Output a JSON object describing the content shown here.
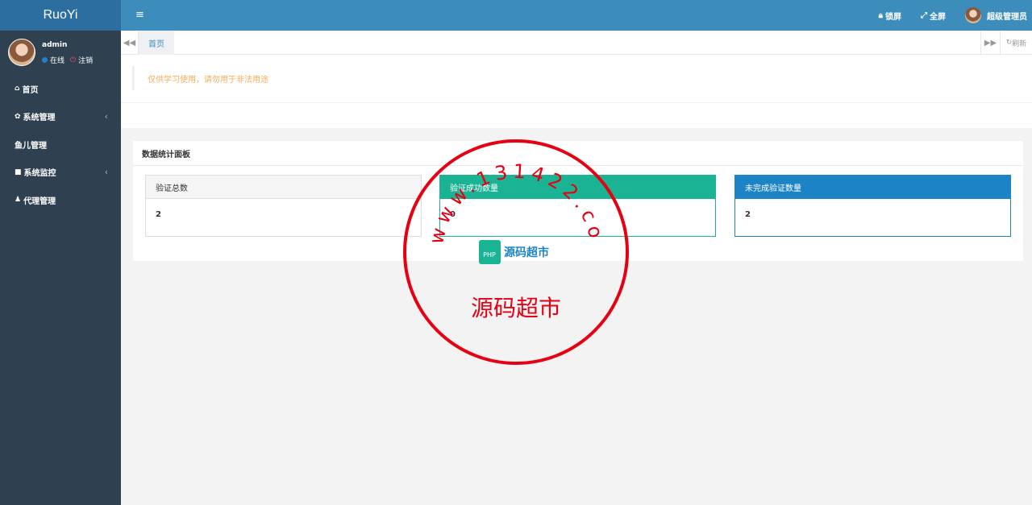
{
  "sidebar": {
    "logo": "RuoYi",
    "user": {
      "name": "admin",
      "status": "在线",
      "logout": "注销"
    },
    "items": [
      {
        "label": "首页",
        "icon": "home-icon",
        "glyph": "⌂"
      },
      {
        "label": "系统管理",
        "icon": "gear-icon",
        "glyph": "✿",
        "arrow": "‹"
      },
      {
        "label": "鱼儿管理",
        "icon": "",
        "glyph": ""
      },
      {
        "label": "系统监控",
        "icon": "video-icon",
        "glyph": "■",
        "arrow": "‹"
      },
      {
        "label": "代理管理",
        "icon": "user-icon",
        "glyph": "♟"
      }
    ]
  },
  "header": {
    "menu_glyph": "≡",
    "lock_label": "锁屏",
    "fullscreen_label": "全屏",
    "user_label": "超级管理员"
  },
  "tabs": {
    "home": "首页",
    "refresh": "刷新"
  },
  "notice": "仅供学习使用，请勿用于非法用途",
  "stats": {
    "title": "数据统计面板",
    "cards": [
      {
        "label": "验证总数",
        "value": "2"
      },
      {
        "label": "验证成功数量",
        "value": "0"
      },
      {
        "label": "未完成验证数量",
        "value": "2"
      }
    ]
  },
  "watermark": {
    "url": "www.131422.com",
    "name": "源码超市",
    "logo_badge": "PHP",
    "logo_text": "源码超市",
    "color": "#e60012"
  },
  "colors": {
    "sidebar_bg": "#2f4050",
    "header_bg": "#3c8dbc",
    "green": "#1ab394",
    "blue": "#1c84c6",
    "notice": "#f8ac59"
  }
}
